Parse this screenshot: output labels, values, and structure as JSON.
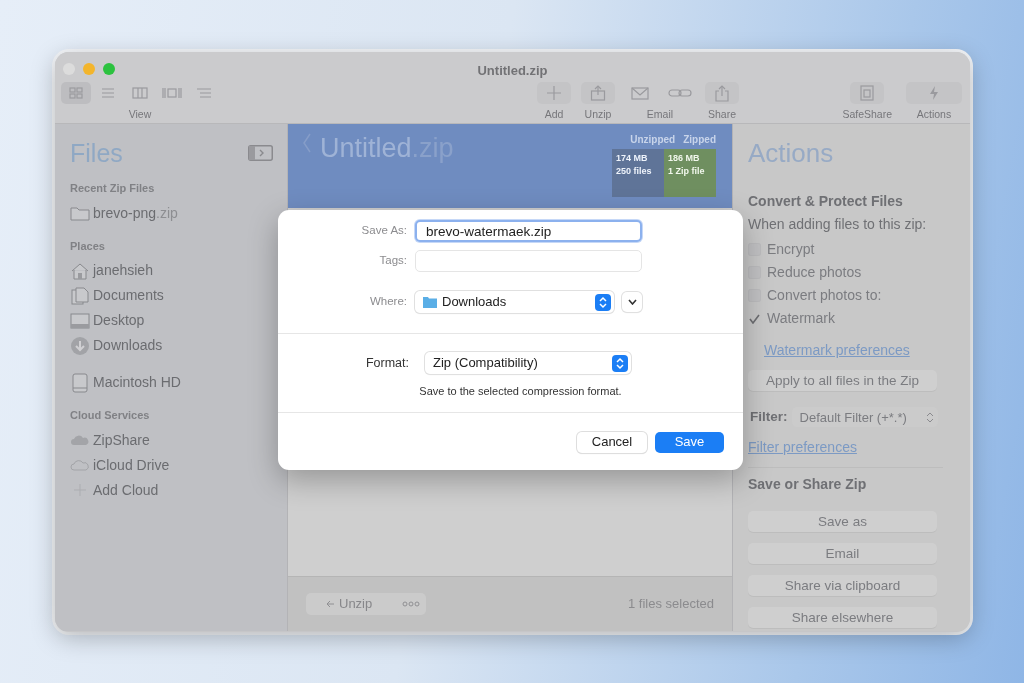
{
  "window": {
    "title": "Untitled.zip"
  },
  "toolbar": {
    "view": {
      "label": "View",
      "items": [
        {
          "kind": "grid",
          "selected": true
        },
        {
          "kind": "list",
          "selected": false
        },
        {
          "kind": "columns",
          "selected": false
        },
        {
          "kind": "gallery",
          "selected": false
        },
        {
          "kind": "outline",
          "selected": false
        }
      ]
    },
    "groups": [
      {
        "kind": "add",
        "label": "Add"
      },
      {
        "kind": "unzip",
        "label": "Unzip"
      },
      {
        "kind": "email",
        "label": "Email"
      },
      {
        "kind": "share",
        "label": "Share"
      }
    ],
    "right_groups": [
      {
        "kind": "safeshare",
        "label": "SafeShare"
      },
      {
        "kind": "actions",
        "label": "Actions"
      }
    ]
  },
  "sidebar": {
    "title": "Files",
    "sections": [
      {
        "heading": "Recent Zip Files",
        "items": [
          {
            "kind": "folder",
            "label": "brevo-png",
            "extension": ".zip"
          }
        ]
      },
      {
        "heading": "Places",
        "items": [
          {
            "kind": "home",
            "label": "janehsieh"
          },
          {
            "kind": "documents",
            "label": "Documents"
          },
          {
            "kind": "desktop",
            "label": "Desktop"
          },
          {
            "kind": "downloads",
            "label": "Downloads"
          }
        ]
      },
      {
        "items": [
          {
            "kind": "disk",
            "label": "Macintosh HD"
          }
        ]
      },
      {
        "heading": "Cloud Services",
        "items": [
          {
            "kind": "cloud_filled",
            "label": "ZipShare"
          },
          {
            "kind": "cloud",
            "label": "iCloud Drive"
          },
          {
            "kind": "add",
            "label": "Add Cloud"
          }
        ]
      }
    ]
  },
  "archive": {
    "name": "Untitled",
    "extension": ".zip",
    "unzipped": {
      "heading": "Unzipped",
      "size": "174 MB",
      "count": "250 files"
    },
    "zipped": {
      "heading": "Zipped",
      "size": "186 MB",
      "count": "1 Zip file"
    }
  },
  "bottom_bar": {
    "unzip_button": "Unzip",
    "status": "1 files selected"
  },
  "actions": {
    "title": "Actions",
    "convert_heading": "Convert & Protect Files",
    "convert_subtitle": "When adding files to this zip:",
    "options": [
      {
        "label": "Encrypt",
        "checked": false
      },
      {
        "label": "Reduce photos",
        "checked": false
      },
      {
        "label": "Convert photos to:",
        "checked": false
      },
      {
        "label": "Watermark",
        "checked": true
      }
    ],
    "watermark_link": "Watermark preferences",
    "apply_button": "Apply to all files in the Zip",
    "filter_label": "Filter:",
    "filter_value": "Default Filter (+*.*)",
    "filter_link": "Filter preferences",
    "share_heading": "Save or Share Zip",
    "share_buttons": [
      "Save as",
      "Email",
      "Share via clipboard",
      "Share elsewhere"
    ]
  },
  "dialog": {
    "save_as_label": "Save As:",
    "save_as_value": "brevo-watermaek.zip",
    "tags_label": "Tags:",
    "where_label": "Where:",
    "where_value": "Downloads",
    "format_label": "Format:",
    "format_value": "Zip (Compatibility)",
    "format_note": "Save to the selected compression format.",
    "buttons": [
      {
        "label": "Cancel",
        "kind": "secondary"
      },
      {
        "label": "Save",
        "kind": "primary"
      }
    ]
  }
}
